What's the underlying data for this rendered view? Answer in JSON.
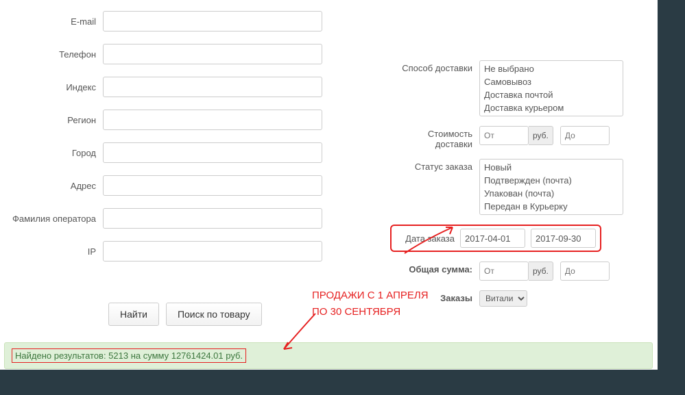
{
  "left": {
    "email_label": "E-mail",
    "phone_label": "Телефон",
    "index_label": "Индекс",
    "region_label": "Регион",
    "city_label": "Город",
    "address_label": "Адрес",
    "operator_label": "Фамилия оператора",
    "ip_label": "IP"
  },
  "right": {
    "delivery_method_label": "Способ доставки",
    "delivery_options": [
      "Не выбрано",
      "Самовывоз",
      "Доставка почтой",
      "Доставка курьером"
    ],
    "delivery_cost_label": "Стоимость доставки",
    "from_placeholder": "От",
    "to_placeholder": "До",
    "rub_addon": "руб.",
    "status_label": "Статус заказа",
    "status_options": [
      "Новый",
      "Подтвержден (почта)",
      "Упакован (почта)",
      "Передан в Курьерку"
    ],
    "date_label": "Дата заказа",
    "date_from": "2017-04-01",
    "date_to": "2017-09-30",
    "total_label": "Общая сумма:",
    "orders_label": "Заказы",
    "orders_selected": "Витали"
  },
  "buttons": {
    "search": "Найти",
    "search_by_product": "Поиск по товару"
  },
  "result_text": "Найдено результатов: 5213 на сумму 12761424.01 руб.",
  "annotation": {
    "line1": "ПРОДАЖИ С 1 АПРЕЛЯ",
    "line2": "ПО 30 СЕНТЯБРЯ"
  }
}
